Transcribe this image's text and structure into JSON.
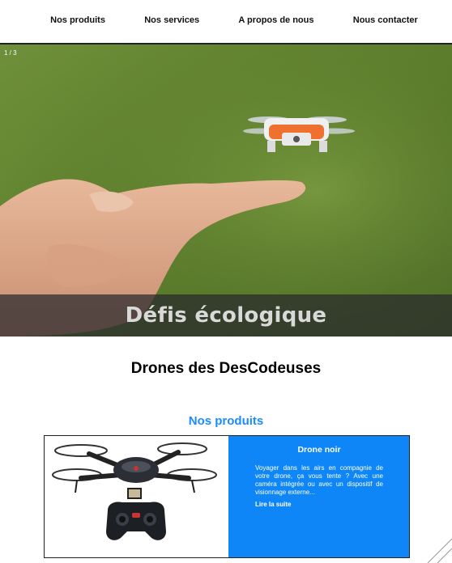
{
  "nav": {
    "items": [
      {
        "label": "Nos produits"
      },
      {
        "label": "Nos services"
      },
      {
        "label": "A propos de nous"
      },
      {
        "label": "Nous contacter"
      }
    ]
  },
  "slider": {
    "counter": "1 / 3",
    "caption": "Défis écologique"
  },
  "site_title": "Drones des DesCodeuses",
  "products": {
    "section_title": "Nos produits",
    "card": {
      "title": "Drone noir",
      "text": "Voyager dans les airs en compagnie de votre drone, ça vous tente ? Avec une caméra intégrée ou avec un dispositif de visionnage externe...",
      "link": "Lire la suite"
    }
  },
  "colors": {
    "accent": "#1a8cff",
    "card_bg": "#0f86f7"
  }
}
